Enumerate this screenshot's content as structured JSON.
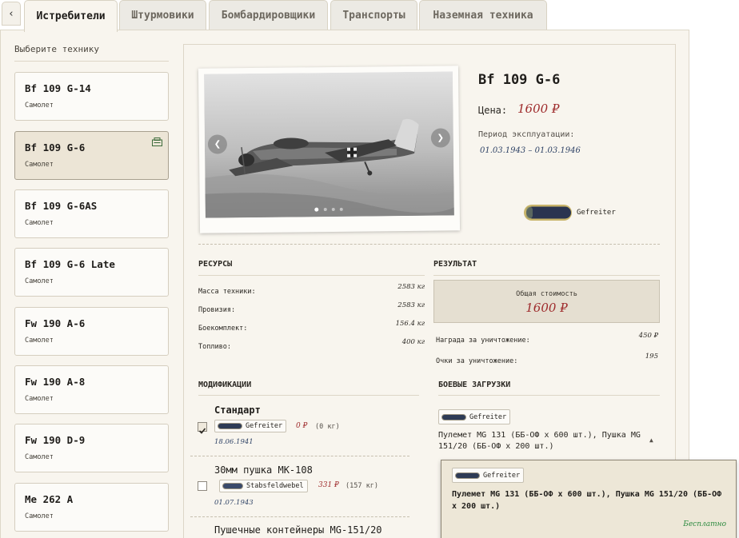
{
  "tabs": {
    "back": "‹",
    "items": [
      "Истребители",
      "Штурмовики",
      "Бомбардировщики",
      "Транспорты",
      "Наземная техника"
    ],
    "active": 0
  },
  "sidebar": {
    "title": "Выберите технику",
    "items": [
      {
        "name": "Bf 109 G-14",
        "type": "Самолет"
      },
      {
        "name": "Bf 109 G-6",
        "type": "Самолет",
        "selected": true
      },
      {
        "name": "Bf 109 G-6AS",
        "type": "Самолет"
      },
      {
        "name": "Bf 109 G-6 Late",
        "type": "Самолет"
      },
      {
        "name": "Fw 190 A-6",
        "type": "Самолет"
      },
      {
        "name": "Fw 190 A-8",
        "type": "Самолет"
      },
      {
        "name": "Fw 190 D-9",
        "type": "Самолет"
      },
      {
        "name": "Me 262 A",
        "type": "Самолет"
      }
    ]
  },
  "vehicle": {
    "name": "Bf 109 G-6",
    "price_label": "Цена:",
    "price": "1600 ₽",
    "period_label": "Период эксплуатации:",
    "period": "01.03.1943 – 01.03.1946",
    "rank": "Gefreiter"
  },
  "resources": {
    "title": "РЕСУРСЫ",
    "rows": [
      {
        "label": "Масса техники:",
        "value": "2583 кг"
      },
      {
        "label": "Провизия:",
        "value": "2583 кг"
      },
      {
        "label": "Боекомплект:",
        "value": "156.4 кг"
      },
      {
        "label": "Топливо:",
        "value": "400 кг"
      }
    ]
  },
  "result": {
    "title": "РЕЗУЛЬТАТ",
    "total_label": "Общая стоимость",
    "total_value": "1600 ₽",
    "rows": [
      {
        "label": "Награда за уничтожение:",
        "value": "450 ₽"
      },
      {
        "label": "Очки за уничтожение:",
        "value": "195"
      }
    ]
  },
  "modifications": {
    "title": "МОДИФИКАЦИИ",
    "items": [
      {
        "name": "Стандарт",
        "rank": "Gefreiter",
        "cost": "0 ₽",
        "weight": "(0 кг)",
        "date": "18.06.1941",
        "checked": true
      },
      {
        "name": "30мм пушка MK-108",
        "rank": "Stabsfeldwebel",
        "cost": "331 ₽",
        "weight": "(157 кг)",
        "date": "01.07.1943",
        "checked": false
      },
      {
        "name": "Пушечные контейнеры MG-151/20"
      }
    ]
  },
  "loadouts": {
    "title": "БОЕВЫЕ ЗАГРУЗКИ",
    "selected_rank": "Gefreiter",
    "selected_text": "Пулемет MG 131 (ББ-ОФ x 600 шт.), Пушка MG 151/20 (ББ-ОФ x 200 шт.)",
    "option_rank": "Gefreiter",
    "option_text": "Пулемет MG 131 (ББ-ОФ x 600 шт.), Пушка MG 151/20 (ББ-ОФ x 200 шт.)",
    "option_price": "Бесплатно"
  },
  "colors": {
    "accent_price": "#9e2a2b",
    "date_blue": "#2f4366",
    "free_green": "#2b8a3e"
  }
}
